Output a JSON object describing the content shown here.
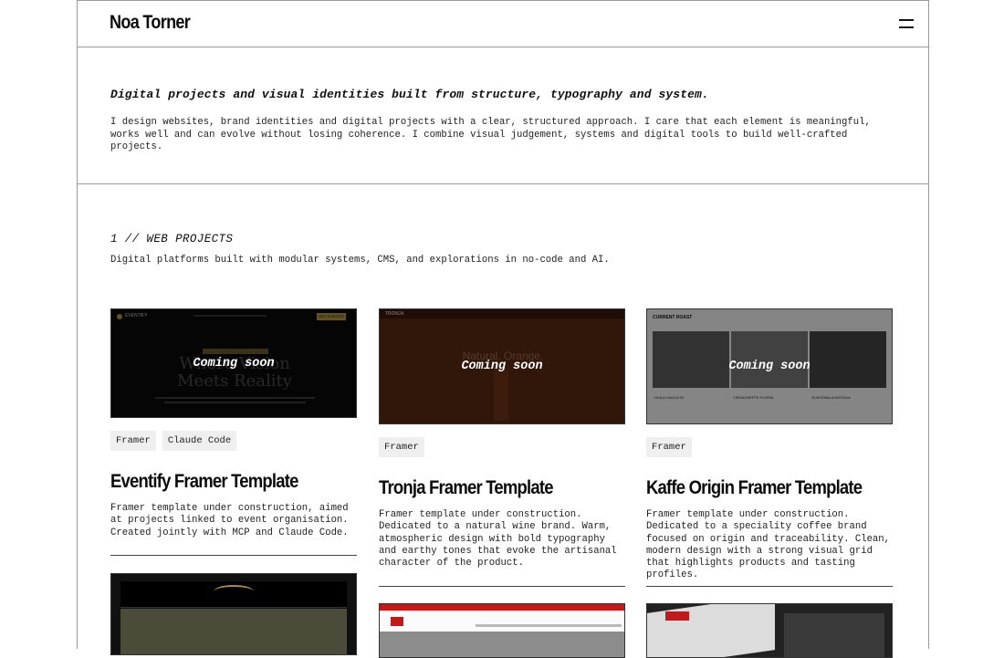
{
  "header": {
    "logo": "Noa Torner",
    "menu_icon": "hamburger-menu-icon"
  },
  "intro": {
    "tagline": "Digital projects and visual identities built from structure, typography and system.",
    "bio": "I design websites, brand identities and digital projects with a clear, structured approach. I care that each element is meaningful, works well and can evolve without losing coherence. I combine visual judgement, systems and digital tools to build well-crafted projects."
  },
  "section": {
    "title": "1 // WEB PROJECTS",
    "subtitle": "Digital platforms built with modular systems, CMS, and explorations in no-code and AI."
  },
  "projects": [
    {
      "title": "Eventify Framer Template",
      "overlay": "Coming soon",
      "tags": [
        "Framer",
        "Claude Code"
      ],
      "description": "Framer template under construction, aimed at projects linked to event organisation. Created jointly with MCP and Claude Code.",
      "thumb_headline_1": "Where Vision",
      "thumb_headline_2": "Meets Reality",
      "thumb_brand": "EVENTIFY",
      "thumb_cta": "GET STARTED"
    },
    {
      "title": "Tronja Framer Template",
      "overlay": "Coming soon",
      "tags": [
        "Framer"
      ],
      "description": "Framer template under construction. Dedicated to a natural wine brand. Warm, atmospheric design with bold typography and earthy tones that evoke the artisanal character of the product.",
      "thumb_headline": "Natural. Orange.",
      "thumb_brand": "TRONJA"
    },
    {
      "title": "Kaffe Origin Framer Template",
      "overlay": "Coming soon",
      "tags": [
        "Framer"
      ],
      "description": "Framer template under construction. Dedicated to a speciality coffee brand focused on origin and traceability. Clean, modern design with a strong visual grid that highlights products and tasting profiles.",
      "thumb_heading": "CURRENT ROAST",
      "thumb_products": [
        "HUILA CAUCA 02",
        "YIRGACHEFFE FLORAL",
        "GUATEMALA ANTIGUA"
      ]
    }
  ],
  "colors": {
    "accent_gold": "#b5963c",
    "wine_orange": "#4a1d0c",
    "border": "#9a9a9a",
    "tag_bg": "#efefef"
  }
}
